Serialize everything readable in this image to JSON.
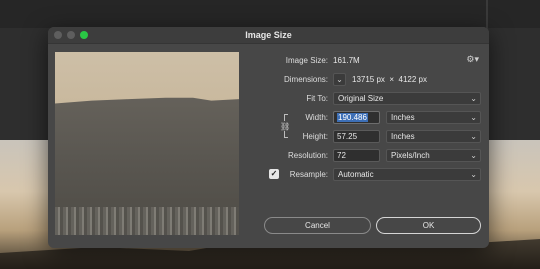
{
  "dialog": {
    "title": "Image Size",
    "controls": [
      "close",
      "minimize",
      "zoom"
    ]
  },
  "image_size": {
    "label": "Image Size:",
    "value": "161.7M"
  },
  "dimensions": {
    "label": "Dimensions:",
    "width": "13715 px",
    "times": "×",
    "height": "4122 px"
  },
  "fit_to": {
    "label": "Fit To:",
    "value": "Original Size"
  },
  "width": {
    "label": "Width:",
    "value": "190.486",
    "unit": "Inches"
  },
  "height": {
    "label": "Height:",
    "value": "57.25",
    "unit": "Inches"
  },
  "resolution": {
    "label": "Resolution:",
    "value": "72",
    "unit": "Pixels/Inch"
  },
  "resample": {
    "label": "Resample:",
    "checked": true,
    "value": "Automatic"
  },
  "buttons": {
    "cancel": "Cancel",
    "ok": "OK"
  },
  "icons": {
    "settings": "gear-icon",
    "chevron": "chevron-down-icon",
    "link": "chain-link-icon",
    "check": "checkmark-icon"
  },
  "colors": {
    "accent": "#3d6fb6",
    "zoom_button": "#2ac845"
  }
}
